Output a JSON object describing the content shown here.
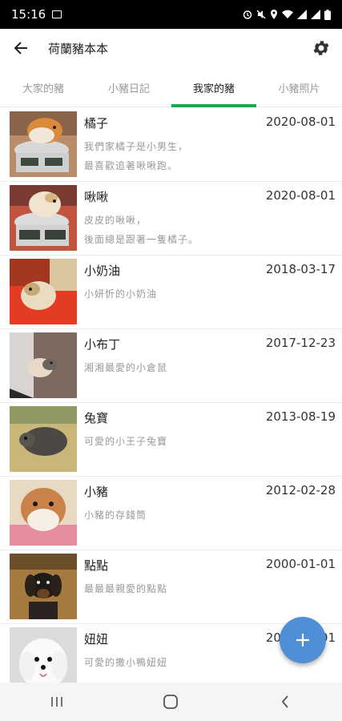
{
  "status": {
    "time": "15:16"
  },
  "app": {
    "title": "荷蘭豬本本"
  },
  "tabs": [
    {
      "label": "大家的豬"
    },
    {
      "label": "小豬日記"
    },
    {
      "label": "我家的豬"
    },
    {
      "label": "小豬照片"
    }
  ],
  "active_tab": "我家的豬",
  "pets": [
    {
      "name": "橘子",
      "date": "2020-08-01",
      "desc": [
        "我們家橘子是小男生，",
        "最喜歡追著啾啾跑。"
      ],
      "photo": "guinea-pig-on-scale-orange"
    },
    {
      "name": "啾啾",
      "date": "2020-08-01",
      "desc": [
        "皮皮的啾啾，",
        "後面總是跟著一隻橘子。"
      ],
      "photo": "guinea-pig-on-scale-white"
    },
    {
      "name": "小奶油",
      "date": "2018-03-17",
      "desc": [
        "小妍忻的小奶油"
      ],
      "photo": "guinea-pig-on-red"
    },
    {
      "name": "小布丁",
      "date": "2017-12-23",
      "desc": [
        "湘湘最愛的小倉鼠"
      ],
      "photo": "hamster-in-hand"
    },
    {
      "name": "兔寶",
      "date": "2013-08-19",
      "desc": [
        "可愛的小王子兔寶"
      ],
      "photo": "dark-guinea-pig"
    },
    {
      "name": "小豬",
      "date": "2012-02-28",
      "desc": [
        "小豬的存錢筒"
      ],
      "photo": "guinea-pig-piggy-bank"
    },
    {
      "name": "點點",
      "date": "2000-01-01",
      "desc": [
        "最最最親愛的點點"
      ],
      "photo": "dachshund"
    },
    {
      "name": "妞妞",
      "date": "2000-01-01",
      "desc": [
        "可愛的撒小鴨妞妞"
      ],
      "photo": "white-maltese"
    }
  ],
  "icons": {
    "back": "arrow-back-icon",
    "settings": "gear-icon",
    "fab": "plus-icon"
  },
  "colors": {
    "accent": "#21a44d",
    "fab": "#4f8fd6"
  }
}
